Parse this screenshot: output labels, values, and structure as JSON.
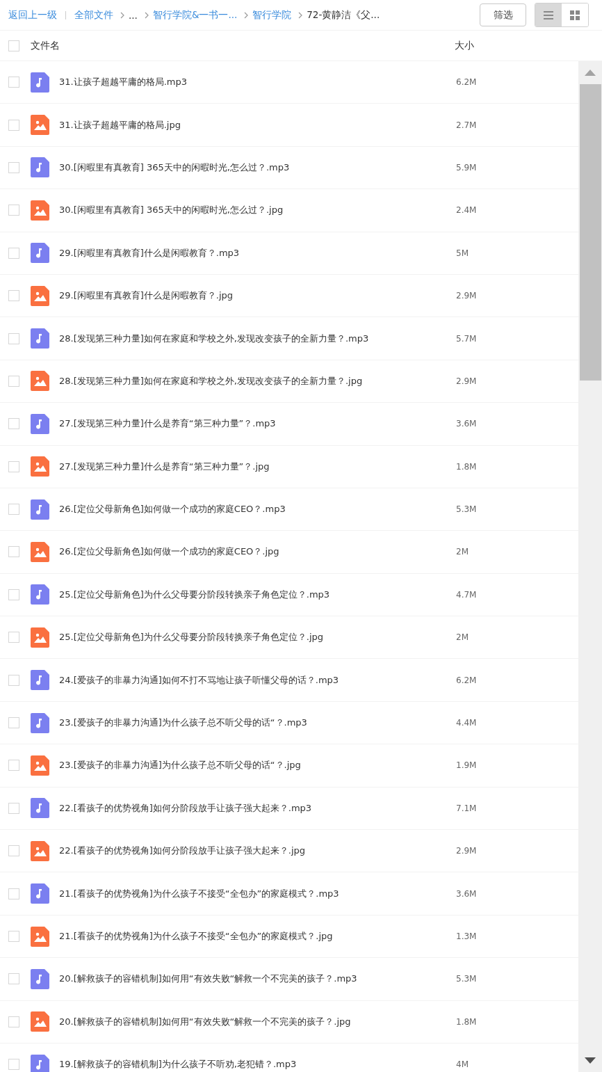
{
  "breadcrumb": {
    "back": "返回上一级",
    "items": [
      {
        "label": "全部文件",
        "link": true
      },
      {
        "label": "...",
        "link": false
      },
      {
        "label": "智行学院&一书一...",
        "link": true
      },
      {
        "label": "智行学院",
        "link": true
      },
      {
        "label": "72-黄静洁《父...",
        "link": false
      }
    ]
  },
  "filter_button": "筛选",
  "view_modes": [
    {
      "kind": "list",
      "selected": true
    },
    {
      "kind": "grid",
      "selected": false
    }
  ],
  "columns": {
    "select_all": {
      "checked": false
    },
    "name": "文件名",
    "size": "大小"
  },
  "files": [
    {
      "kind": "audio",
      "name": "31.让孩子超越平庸的格局.mp3",
      "size": "6.2M",
      "checked": false
    },
    {
      "kind": "image",
      "name": "31.让孩子超越平庸的格局.jpg",
      "size": "2.7M",
      "checked": false
    },
    {
      "kind": "audio",
      "name": "30.[闲暇里有真教育] 365天中的闲暇时光,怎么过？.mp3",
      "size": "5.9M",
      "checked": false
    },
    {
      "kind": "image",
      "name": "30.[闲暇里有真教育] 365天中的闲暇时光,怎么过？.jpg",
      "size": "2.4M",
      "checked": false
    },
    {
      "kind": "audio",
      "name": "29.[闲暇里有真教育]什么是闲暇教育？.mp3",
      "size": "5M",
      "checked": false
    },
    {
      "kind": "image",
      "name": "29.[闲暇里有真教育]什么是闲暇教育？.jpg",
      "size": "2.9M",
      "checked": false
    },
    {
      "kind": "audio",
      "name": "28.[发现第三种力量]如何在家庭和学校之外,发现改变孩子的全新力量？.mp3",
      "size": "5.7M",
      "checked": false
    },
    {
      "kind": "image",
      "name": "28.[发现第三种力量]如何在家庭和学校之外,发现改变孩子的全新力量？.jpg",
      "size": "2.9M",
      "checked": false
    },
    {
      "kind": "audio",
      "name": "27.[发现第三种力量]什么是养育“第三种力量”？.mp3",
      "size": "3.6M",
      "checked": false
    },
    {
      "kind": "image",
      "name": "27.[发现第三种力量]什么是养育“第三种力量”？.jpg",
      "size": "1.8M",
      "checked": false
    },
    {
      "kind": "audio",
      "name": "26.[定位父母新角色]如何做一个成功的家庭CEO？.mp3",
      "size": "5.3M",
      "checked": false
    },
    {
      "kind": "image",
      "name": "26.[定位父母新角色]如何做一个成功的家庭CEO？.jpg",
      "size": "2M",
      "checked": false
    },
    {
      "kind": "audio",
      "name": "25.[定位父母新角色]为什么父母要分阶段转换亲子角色定位？.mp3",
      "size": "4.7M",
      "checked": false
    },
    {
      "kind": "image",
      "name": "25.[定位父母新角色]为什么父母要分阶段转换亲子角色定位？.jpg",
      "size": "2M",
      "checked": false
    },
    {
      "kind": "audio",
      "name": "24.[爱孩子的非暴力沟通]如何不打不骂地让孩子听懂父母的话？.mp3",
      "size": "6.2M",
      "checked": false
    },
    {
      "kind": "audio",
      "name": "23.[爱孩子的非暴力沟通]为什么孩子总不听父母的话“？.mp3",
      "size": "4.4M",
      "checked": false
    },
    {
      "kind": "image",
      "name": "23.[爱孩子的非暴力沟通]为什么孩子总不听父母的话“？.jpg",
      "size": "1.9M",
      "checked": false
    },
    {
      "kind": "audio",
      "name": "22.[看孩子的优势视角]如何分阶段放手让孩子强大起来？.mp3",
      "size": "7.1M",
      "checked": false
    },
    {
      "kind": "image",
      "name": "22.[看孩子的优势视角]如何分阶段放手让孩子强大起来？.jpg",
      "size": "2.9M",
      "checked": false
    },
    {
      "kind": "audio",
      "name": "21.[看孩子的优势视角]为什么孩子不接受“全包办”的家庭模式？.mp3",
      "size": "3.6M",
      "checked": false
    },
    {
      "kind": "image",
      "name": "21.[看孩子的优势视角]为什么孩子不接受“全包办”的家庭模式？.jpg",
      "size": "1.3M",
      "checked": false
    },
    {
      "kind": "audio",
      "name": "20.[解救孩子的容错机制]如何用“有效失败“解救一个不完美的孩子？.mp3",
      "size": "5.3M",
      "checked": false
    },
    {
      "kind": "image",
      "name": "20.[解救孩子的容错机制]如何用“有效失败“解救一个不完美的孩子？.jpg",
      "size": "1.8M",
      "checked": false
    },
    {
      "kind": "audio",
      "name": "19.[解救孩子的容错机制]为什么孩子不听劝,老犯错？.mp3",
      "size": "4M",
      "checked": false
    }
  ]
}
